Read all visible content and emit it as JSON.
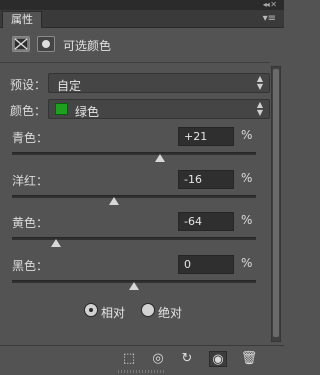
{
  "window": {
    "controls": "◂◂ ✕",
    "tab_label": "属性",
    "tab_menu": "▾≡"
  },
  "header": {
    "title": "可选颜色"
  },
  "preset": {
    "label": "预设：",
    "value": "自定"
  },
  "colors": {
    "label": "颜色：",
    "value": "绿色",
    "swatch_color": "#1f9f1f"
  },
  "sliders": [
    {
      "label": "青色：",
      "value": "+21",
      "unit": "%",
      "level": 0.605
    },
    {
      "label": "洋红：",
      "value": "-16",
      "unit": "%",
      "level": 0.42
    },
    {
      "label": "黄色：",
      "value": "-64",
      "unit": "%",
      "level": 0.18
    },
    {
      "label": "黑色：",
      "value": "0",
      "unit": "%",
      "level": 0.5
    }
  ],
  "method": {
    "options": [
      "相对",
      "绝对"
    ],
    "selected": "相对"
  },
  "bottom_icons": [
    "clip-to-layer-icon",
    "view-previous-state-icon",
    "reset-icon",
    "visibility-eye-icon",
    "trash-icon"
  ],
  "bottom_glyphs": {
    "clip": "⬚",
    "prev": "◎",
    "reset": "↻",
    "eye": "◉",
    "trash": "🗑"
  }
}
